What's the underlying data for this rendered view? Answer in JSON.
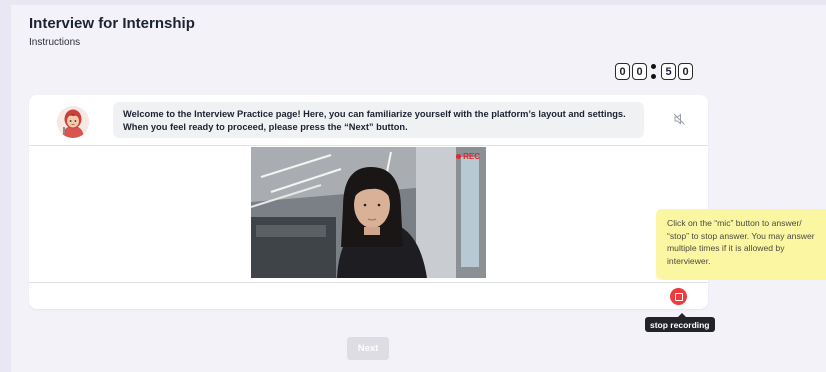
{
  "page": {
    "title": "Interview for Internship",
    "subtitle": "Instructions"
  },
  "timer": {
    "digits": [
      "0",
      "0",
      "5",
      "0"
    ]
  },
  "interviewer": {
    "message_line1": "Welcome to the Interview Practice page! Here, you can familiarize yourself with the platform’s layout and settings.",
    "message_line2": "When you feel ready to proceed, please press the “Next” button.",
    "avatar_icon": "interviewer-avatar",
    "mute_icon": "speaker-muted-icon"
  },
  "video": {
    "rec_label": "REC"
  },
  "controls": {
    "stop_icon": "stop-recording-icon",
    "stop_tooltip": "stop recording",
    "next_label": "Next"
  },
  "hint": {
    "line1": "Click on the “mic” button to answer/",
    "line2": "“stop” to stop answer. You may answer",
    "line3": "multiple times if it is allowed by",
    "line4": "interviewer."
  },
  "colors": {
    "background": "#f3f2f8",
    "accent_red": "#ef3b3b",
    "hint_yellow": "#fbf6a2",
    "tooltip_dark": "#22242a",
    "next_disabled": "#dddde3"
  }
}
